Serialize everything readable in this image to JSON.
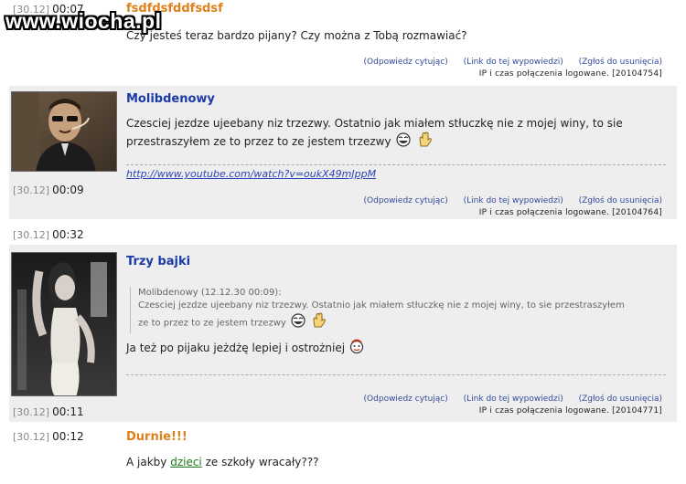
{
  "watermark": "www.wiocha.pl",
  "posts": [
    {
      "date": "[30.12]",
      "time": "00:07",
      "author": "fsdfdsfddfsdsf",
      "text": "Czy jesteś teraz bardzo pijany? Czy można z Tobą rozmawiać?",
      "reply_label": "(Odpowiedz cytując)",
      "link_label": "(Link do tej wypowiedzi)",
      "report_label": "(Zgłoś do usunięcia)",
      "ip_text": "IP i czas połączenia logowane. [20104754]"
    },
    {
      "date": "[30.12]",
      "time": "00:09",
      "author": "Molibdenowy",
      "text_line1": "Czesciej jezdze ujeebany niz trzezwy. Ostatnio jak miałem stłuczkę nie z mojej winy, to sie",
      "text_line2": "przestraszyłem ze to przez to ze jestem trzezwy",
      "link": "http://www.youtube.com/watch?v=oukX49mJppM",
      "reply_label": "(Odpowiedz cytując)",
      "link_label": "(Link do tej wypowiedzi)",
      "report_label": "(Zgłoś do usunięcia)",
      "ip_text": "IP i czas połączenia logowane. [20104764]"
    },
    {
      "date": "[30.12]",
      "time": "00:32",
      "time_bottom": "00:11",
      "author": "Trzy bajki",
      "quote_header": "Molibdenowy (12.12.30 00:09):",
      "quote_line1": "Czesciej jezdze ujeebany niz trzezwy. Ostatnio jak miałem stłuczkę nie z mojej winy, to sie przestraszyłem",
      "quote_line2": "ze to przez to ze jestem trzezwy",
      "text": "Ja też po pijaku jeżdżę lepiej i ostrożniej",
      "reply_label": "(Odpowiedz cytując)",
      "link_label": "(Link do tej wypowiedzi)",
      "report_label": "(Zgłoś do usunięcia)",
      "ip_text": "IP i czas połączenia logowane. [20104771]"
    },
    {
      "date": "[30.12]",
      "time": "00:12",
      "author": "Durnie!!!",
      "text_before": "A jakby ",
      "keyword": "dzieci",
      "text_after": " ze szkoły wracały???"
    }
  ]
}
